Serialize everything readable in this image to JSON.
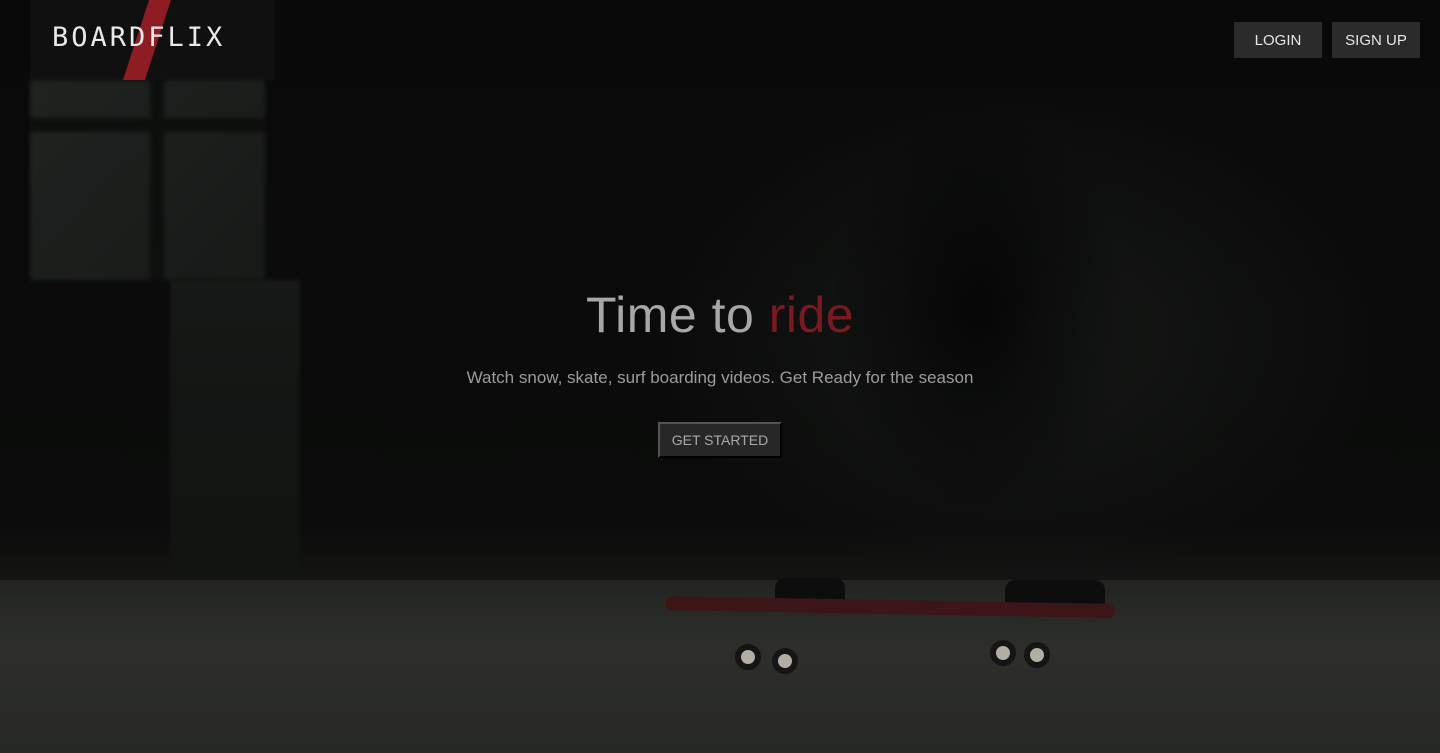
{
  "header": {
    "logo": "BOARDFLIX",
    "login_label": "LOGIN",
    "signup_label": "SIGN UP"
  },
  "hero": {
    "title_start": "Time to ",
    "title_accent": "ride",
    "subtitle": "Watch snow, skate, surf boarding videos. Get Ready for the season",
    "cta_label": "GET STARTED"
  },
  "colors": {
    "accent": "#8d1c23",
    "button_bg": "#2a2b2a"
  }
}
